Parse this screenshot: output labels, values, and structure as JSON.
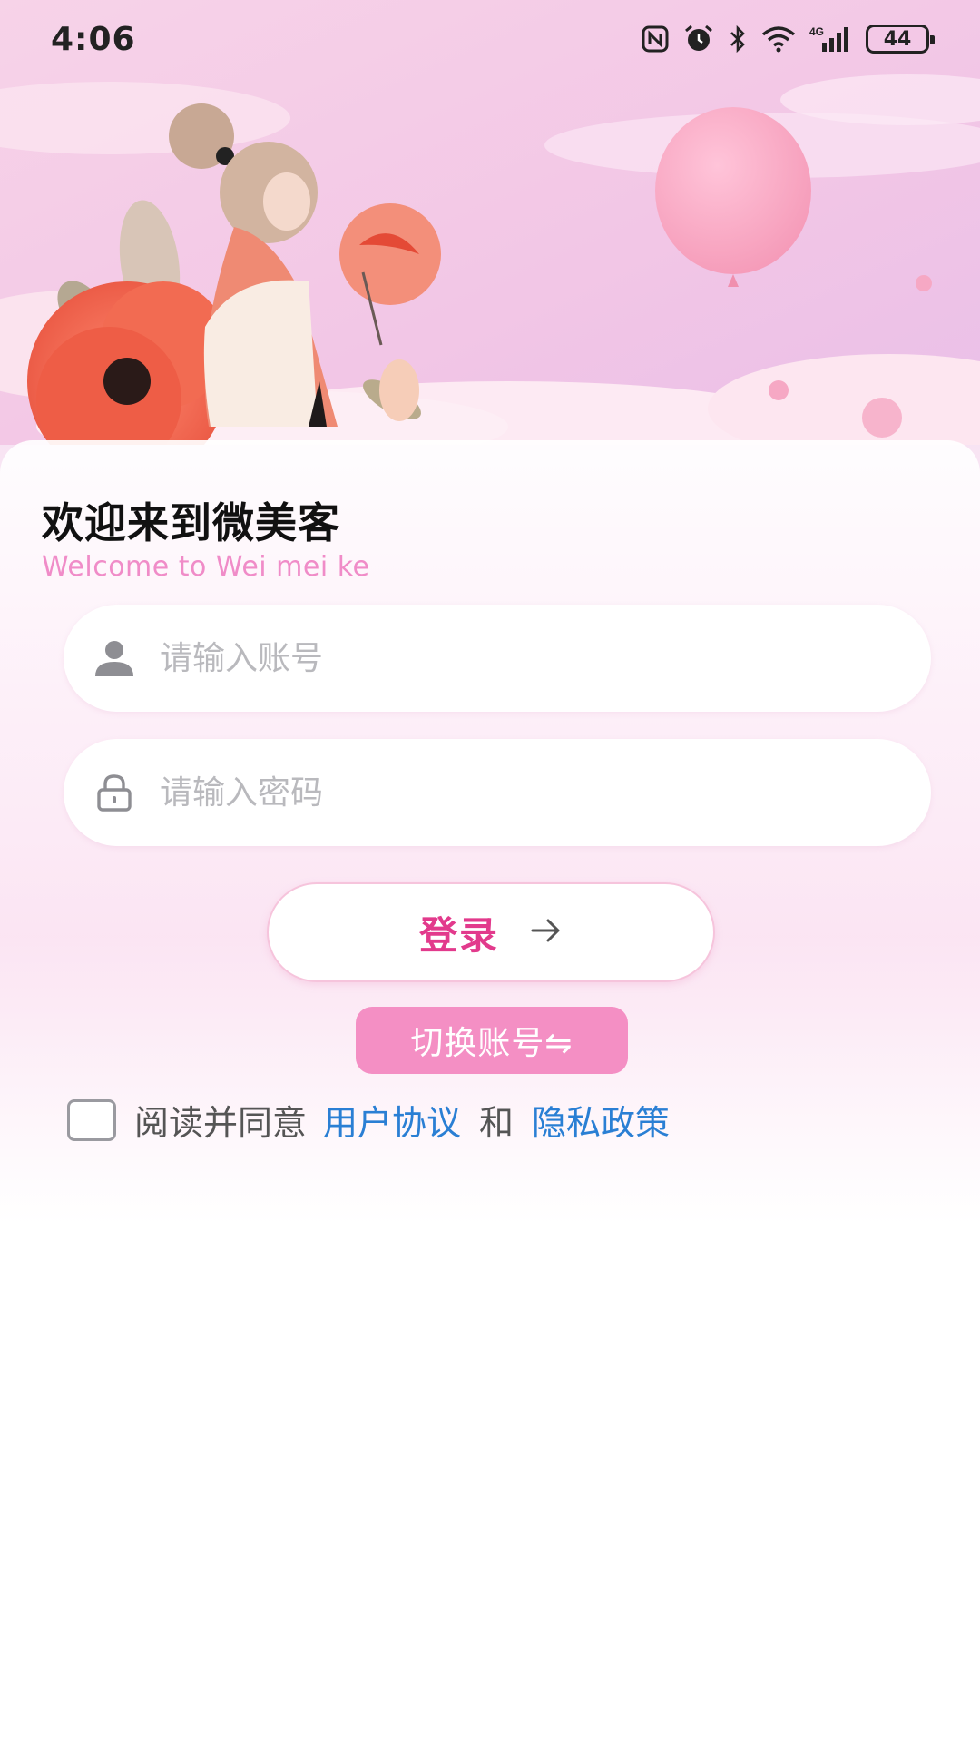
{
  "status_bar": {
    "time": "4:06",
    "battery": "44",
    "icons": [
      "nfc-icon",
      "alarm-icon",
      "bluetooth-icon",
      "wifi-icon",
      "signal-4g-icon",
      "battery-icon"
    ]
  },
  "welcome": {
    "title": "欢迎来到微美客",
    "subtitle": "Welcome to Wei mei ke"
  },
  "form": {
    "account_placeholder": "请输入账号",
    "password_placeholder": "请输入密码",
    "account_icon": "user-icon",
    "password_icon": "lock-icon"
  },
  "actions": {
    "login_label": "登录",
    "login_icon": "arrow-right-icon",
    "switch_label": "切换账号⇋"
  },
  "agreement": {
    "prefix": "阅读并同意",
    "user_agreement": "用户协议",
    "and": "和",
    "privacy_policy": "隐私政策",
    "checked": false
  },
  "colors": {
    "accent": "#e23a8c",
    "switch_bg": "#f48fc4",
    "link": "#2a7fd4",
    "subtitle": "#f08cc8"
  }
}
